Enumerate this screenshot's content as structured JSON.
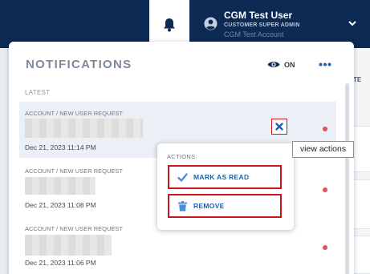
{
  "header": {
    "user_name": "CGM Test User",
    "user_role": "CUSTOMER SUPER ADMIN",
    "account": "CGM Test Account"
  },
  "background": {
    "partial_letters": "TE"
  },
  "notifications": {
    "title": "NOTIFICATIONS",
    "toggle_label": "ON",
    "section_label": "LATEST",
    "items": [
      {
        "category": "ACCOUNT / NEW USER REQUEST",
        "date": "Dec 21, 2023 11:14 PM",
        "unread": true
      },
      {
        "category": "ACCOUNT / NEW USER REQUEST",
        "date": "Dec 21, 2023 11:08 PM",
        "unread": true
      },
      {
        "category": "ACCOUNT / NEW USER REQUEST",
        "date": "Dec 21, 2023 11:06 PM",
        "unread": true
      }
    ]
  },
  "actions_menu": {
    "heading": "ACTIONS:",
    "mark_as_read": "MARK AS READ",
    "remove": "REMOVE"
  },
  "tooltip": {
    "text": "view actions"
  },
  "colors": {
    "navy": "#0c2a53",
    "accent_blue": "#1a61b0",
    "highlight_red": "#c8161c",
    "unread_dot": "#e84f58"
  }
}
